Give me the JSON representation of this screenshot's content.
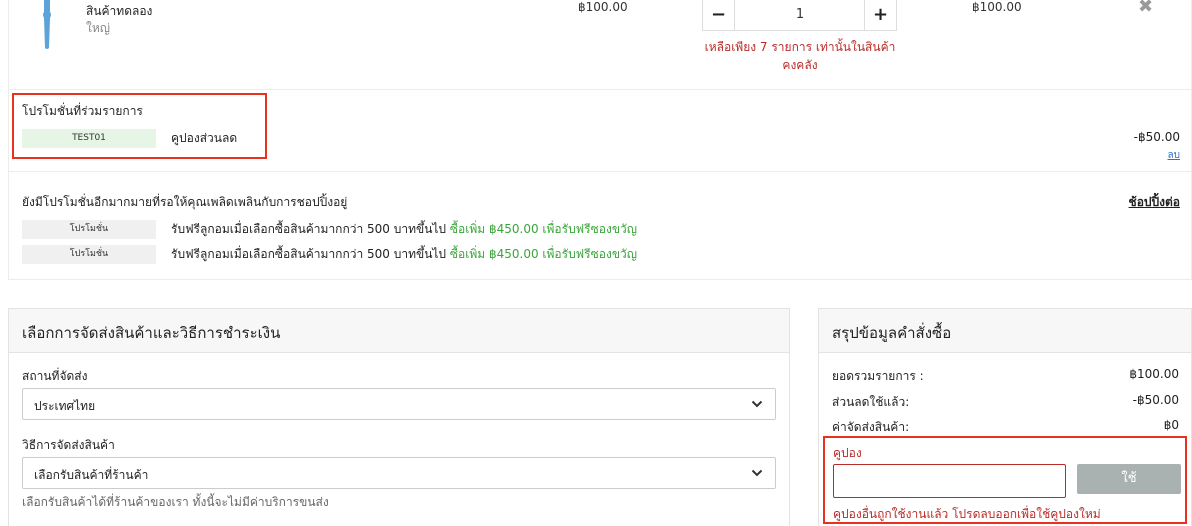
{
  "cart_item": {
    "name": "สินค้าทดลอง",
    "variant": "ใหญ่",
    "price": "฿100.00",
    "quantity": "1",
    "minus_glyph": "−",
    "plus_glyph": "+",
    "stock_warning": "เหลือเพียง 7 รายการ เท่านั้นในสินค้าคงคลัง",
    "line_total": "฿100.00",
    "remove_glyph": "✖",
    "thumb_color": "#5ba3d9"
  },
  "applied_promotions": {
    "heading": "โปรโมชั่นที่ร่วมรายการ",
    "code": "TEST01",
    "name": "คูปองส่วนลด",
    "amount": "-฿50.00",
    "remove_label": "ลบ"
  },
  "more_promotions": {
    "text": "ยังมีโปรโมชั่นอีกมากมายที่รอให้คุณเพลิดเพลินกับการชอปปิ้งอยู่",
    "continue_label": "ช้อปปิ้งต่อ",
    "offers": [
      {
        "tag": "โปรโมชั่น",
        "text": "รับฟรีลูกอมเมื่อเลือกซื้อสินค้ามากกว่า 500 บาทขึ้นไป",
        "highlight": "ซื้อเพิ่ม ฿450.00 เพื่อรับฟรีซองขวัญ"
      },
      {
        "tag": "โปรโมชั่น",
        "text": "รับฟรีลูกอมเมื่อเลือกซื้อสินค้ามากกว่า 500 บาทขึ้นไป",
        "highlight": "ซื้อเพิ่ม ฿450.00 เพื่อรับฟรีซองขวัญ"
      }
    ]
  },
  "shipping": {
    "title": "เลือกการจัดส่งสินค้าและวิธีการชำระเงิน",
    "location_label": "สถานที่จัดส่ง",
    "location_value": "ประเทศไทย",
    "method_label": "วิธีการจัดส่งสินค้า",
    "method_value": "เลือกรับสินค้าที่ร้านค้า",
    "note": "เลือกรับสินค้าได้ที่ร้านค้าของเรา ทั้งนี้จะไม่มีค่าบริการขนส่ง"
  },
  "summary": {
    "title": "สรุปข้อมูลคำสั่งซื้อ",
    "rows": [
      {
        "label": "ยอดรวมรายการ :",
        "value": "฿100.00"
      },
      {
        "label": "ส่วนลดใช้แล้ว:",
        "value": "-฿50.00"
      },
      {
        "label": "ค่าจัดส่งสินค้า:",
        "value": "฿0"
      }
    ],
    "coupon_label": "คูปอง",
    "coupon_value": "",
    "apply_label": "ใช้",
    "coupon_error": "คูปองอื่นถูกใช้งานแล้ว โปรดลบออกเพื่อใช้คูปองใหม่"
  },
  "colors": {
    "annotation": "#e8321e",
    "error": "#b92c28",
    "success": "#3aa53a",
    "link": "#2c6fd1"
  }
}
